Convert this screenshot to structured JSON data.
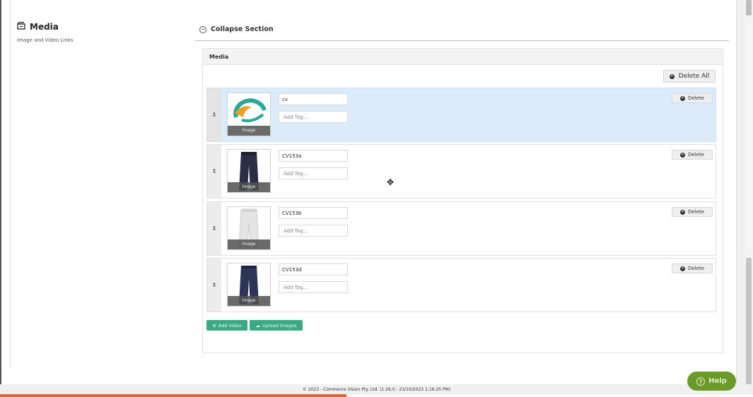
{
  "section": {
    "title": "Media",
    "subtitle": "Image and Video Links",
    "collapse_label": "Collapse Section"
  },
  "panel": {
    "header": "Media",
    "delete_all_label": "Delete All"
  },
  "items": [
    {
      "file_name": "cv",
      "tag_placeholder": "Add Tag...",
      "thumb_label": "Image",
      "delete_label": "Delete",
      "icon": "cv-logo-image"
    },
    {
      "file_name": "CV153a",
      "tag_placeholder": "Add Tag...",
      "thumb_label": "Image",
      "delete_label": "Delete",
      "icon": "dark-pants-image"
    },
    {
      "file_name": "CV153b",
      "tag_placeholder": "Add Tag...",
      "thumb_label": "Image",
      "delete_label": "Delete",
      "icon": "white-pants-image"
    },
    {
      "file_name": "CV153d",
      "tag_placeholder": "Add Tag...",
      "thumb_label": "Image",
      "delete_label": "Delete",
      "icon": "navy-pants-image"
    }
  ],
  "actions": {
    "add_video_label": "Add Video",
    "upload_images_label": "Upload Images"
  },
  "footer": {
    "text": "© 2023 - Commerce Vision Pty. Ltd. (1.26.0 - 23/10/2023 1:16:25 PM)"
  },
  "help": {
    "label": "Help"
  },
  "colors": {
    "selected_row": "#dcebfa",
    "action_green": "#3aaa85",
    "help_green": "#6a9a2a",
    "progress_orange": "#e8622a"
  },
  "load_progress_percent": 46
}
